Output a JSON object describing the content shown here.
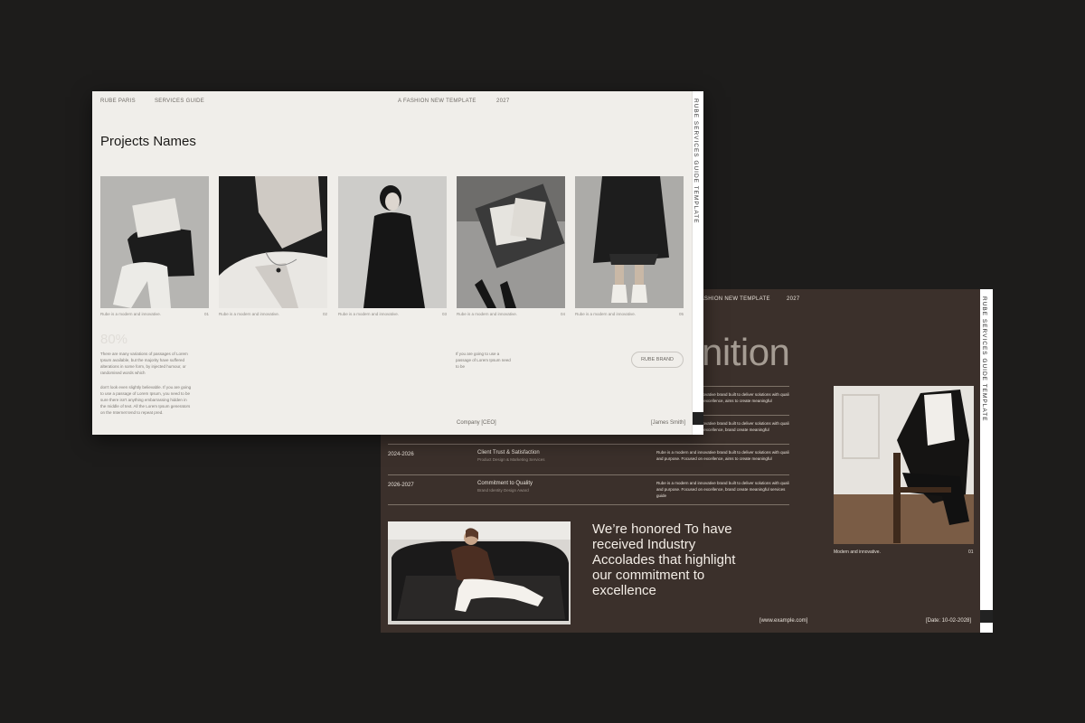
{
  "background": "#1d1c1b",
  "slide_front": {
    "header": {
      "brand": "RUBE PARIS",
      "guide": "SERVICES GUIDE",
      "tagline": "A FASHION NEW TEMPLATE",
      "year": "2027"
    },
    "side_text": "RUBE SERVICES GUIDE TEMPLATE",
    "title": "Projects Names",
    "cards": [
      {
        "caption": "Rube is a modern and innovative.",
        "num": "01"
      },
      {
        "caption": "Rube is a modern and innovative.",
        "num": "02"
      },
      {
        "caption": "Rube is a modern and innovative.",
        "num": "03"
      },
      {
        "caption": "Rube is a modern and innovative.",
        "num": "04"
      },
      {
        "caption": "Rube is a modern and innovative.",
        "num": "05"
      }
    ],
    "percent": "80%",
    "body_1": "There are many variations of passages of Lorem Ipsum available, but the majority have suffered alterations in some form, by injected humour, or randomised words which",
    "body_2": "don't look even slightly believable. If you are going to use a passage of Lorem Ipsum, you need to be sure there isn't anything embarrassing hidden in the middle of text. All the Lorem Ipsum generators on the Internet tend to repeat pred.",
    "body_3": "If you are going to use a passage of Lorem Ipsum need to be",
    "button": "RUBE BRAND",
    "footer_left": "Company [CEO]",
    "footer_right": "[James Smith]"
  },
  "slide_back": {
    "header": {
      "tagline": "FASHION NEW TEMPLATE",
      "year": "2027"
    },
    "side_text": "RUBE SERVICES GUIDE TEMPLATE",
    "big_word": "nition",
    "rows": [
      {
        "desc": "Rube is a modern and innovative brand built to deliver solutions with quali and purpose. Focused on excellence, aims to create meaningful"
      },
      {
        "desc": "Rube is a modern and innovative brand built to deliver solutions with quali and purpose. Focused on excellence, brand create meaningful"
      },
      {
        "years": "2024-2026",
        "title": "Client Trust & Satisfaction",
        "sub": "Product Design & Marketing Services",
        "desc": "Rube is a modern and innovative brand built to deliver solutions with quali and purpose. Focused on excellence, aims to create meaningful"
      },
      {
        "years": "2026-2027",
        "title": "Commitment to Quality",
        "sub": "Brand Identity Design Award",
        "desc": "Rube is a modern and innovative brand built to deliver solutions with quali and purpose. Focused on excellence, brand create meaningful services guide"
      }
    ],
    "quote": "We’re honored To have received Industry Accolades that highlight our commitment to excellence",
    "photo_caption": "Modern and innovative.",
    "photo_num": "01",
    "footer_url": "[www.example.com]",
    "footer_date": "[Date: 10-02-2028]"
  }
}
